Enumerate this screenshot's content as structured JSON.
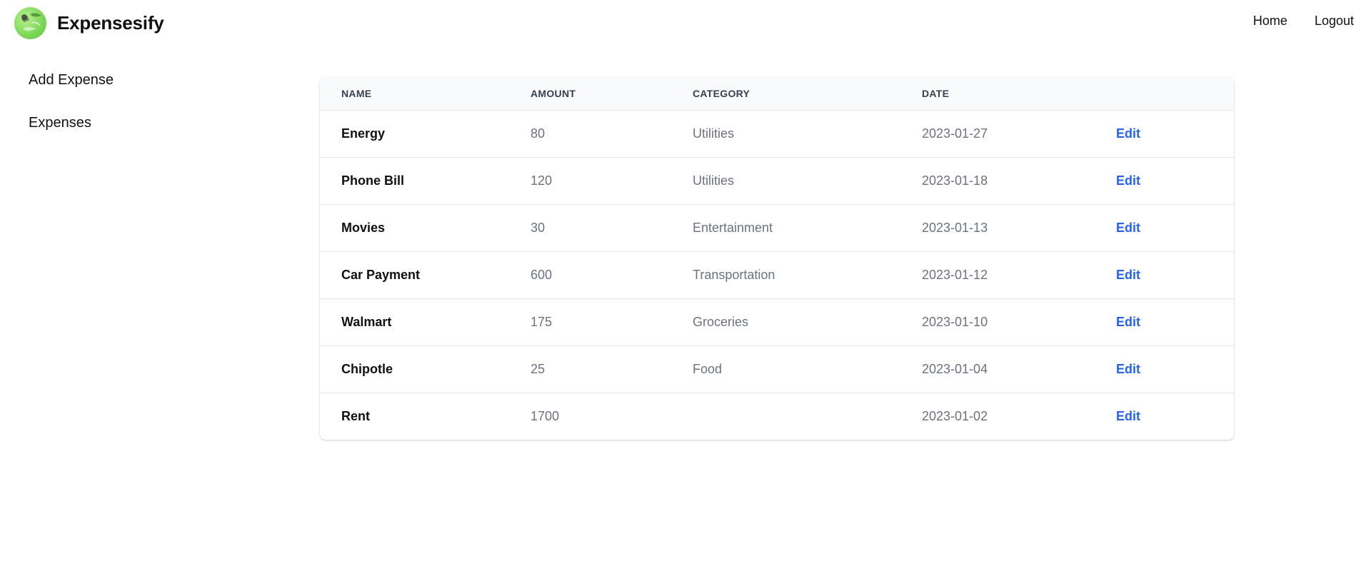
{
  "header": {
    "brand_name": "Expensesify",
    "logo_icon": "expensesify-logo-icon",
    "nav": [
      {
        "label": "Home"
      },
      {
        "label": "Logout"
      }
    ]
  },
  "sidebar": {
    "items": [
      {
        "label": "Add Expense"
      },
      {
        "label": "Expenses"
      }
    ]
  },
  "table": {
    "columns": [
      "NAME",
      "AMOUNT",
      "CATEGORY",
      "DATE",
      ""
    ],
    "rows": [
      {
        "name": "Energy",
        "amount": "80",
        "category": "Utilities",
        "date": "2023-01-27",
        "action": "Edit"
      },
      {
        "name": "Phone Bill",
        "amount": "120",
        "category": "Utilities",
        "date": "2023-01-18",
        "action": "Edit"
      },
      {
        "name": "Movies",
        "amount": "30",
        "category": "Entertainment",
        "date": "2023-01-13",
        "action": "Edit"
      },
      {
        "name": "Car Payment",
        "amount": "600",
        "category": "Transportation",
        "date": "2023-01-12",
        "action": "Edit"
      },
      {
        "name": "Walmart",
        "amount": "175",
        "category": "Groceries",
        "date": "2023-01-10",
        "action": "Edit"
      },
      {
        "name": "Chipotle",
        "amount": "25",
        "category": "Food",
        "date": "2023-01-04",
        "action": "Edit"
      },
      {
        "name": "Rent",
        "amount": "1700",
        "category": "",
        "date": "2023-01-02",
        "action": "Edit"
      }
    ]
  },
  "colors": {
    "link": "#2563eb",
    "header_bg": "#f9fafb",
    "muted_text": "#6b7280",
    "logo_green": "#7fd95a"
  }
}
